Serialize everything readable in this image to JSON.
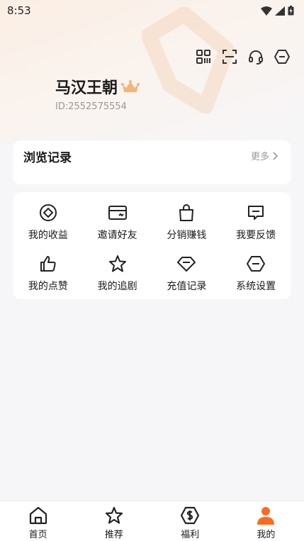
{
  "status_bar": {
    "time": "8:53"
  },
  "profile": {
    "name": "马汉王朝",
    "id_text": "ID:2552575554"
  },
  "top_tools": [
    {
      "icon": "qrcode-icon"
    },
    {
      "icon": "scan-icon"
    },
    {
      "icon": "headset-icon"
    },
    {
      "icon": "settings-hexagon-icon"
    }
  ],
  "history": {
    "title": "浏览记录",
    "more_label": "更多"
  },
  "grid": {
    "items": [
      {
        "label": "我的收益",
        "icon": "earnings-icon"
      },
      {
        "label": "邀请好友",
        "icon": "invite-card-icon"
      },
      {
        "label": "分销赚钱",
        "icon": "shopping-bag-icon"
      },
      {
        "label": "我要反馈",
        "icon": "feedback-icon"
      },
      {
        "label": "我的点赞",
        "icon": "thumbs-up-icon"
      },
      {
        "label": "我的追剧",
        "icon": "star-icon"
      },
      {
        "label": "充值记录",
        "icon": "diamond-icon"
      },
      {
        "label": "系统设置",
        "icon": "settings-hexagon-icon"
      }
    ]
  },
  "bottom_nav": {
    "items": [
      {
        "label": "首页",
        "icon": "home-icon",
        "active": false
      },
      {
        "label": "推荐",
        "icon": "star-icon",
        "active": false
      },
      {
        "label": "福利",
        "icon": "dollar-icon",
        "active": false
      },
      {
        "label": "我的",
        "icon": "user-icon",
        "active": true
      }
    ]
  },
  "colors": {
    "accent": "#ff6a1f",
    "crown": "#f5b57a",
    "text_primary": "#1a1a1a",
    "text_secondary": "#999999"
  }
}
